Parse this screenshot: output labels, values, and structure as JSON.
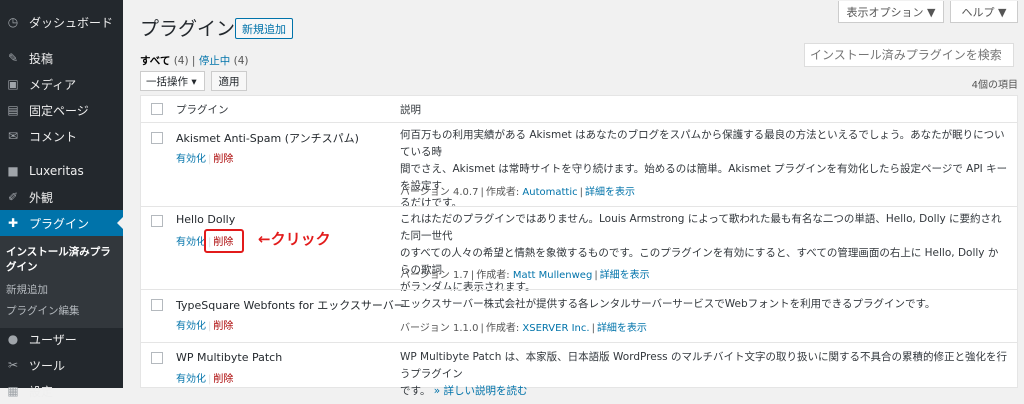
{
  "sidebar": {
    "items": [
      {
        "label": "ダッシュボード",
        "icon": "dashboard-icon",
        "glyph": "◷"
      },
      {
        "label": "投稿",
        "icon": "pin-icon",
        "glyph": "✎"
      },
      {
        "label": "メディア",
        "icon": "media-icon",
        "glyph": "▣"
      },
      {
        "label": "固定ページ",
        "icon": "page-icon",
        "glyph": "▤"
      },
      {
        "label": "コメント",
        "icon": "comment-icon",
        "glyph": "✉"
      },
      {
        "label": "Luxeritas",
        "icon": "theme-icon",
        "glyph": "■"
      },
      {
        "label": "外観",
        "icon": "brush-icon",
        "glyph": "✐"
      },
      {
        "label": "プラグイン",
        "icon": "plugin-icon",
        "glyph": "✚"
      },
      {
        "label": "ユーザー",
        "icon": "user-icon",
        "glyph": "●"
      },
      {
        "label": "ツール",
        "icon": "tool-icon",
        "glyph": "✂"
      },
      {
        "label": "設定",
        "icon": "settings-icon",
        "glyph": "▦"
      }
    ],
    "submenu": {
      "current": "インストール済みプラグイン",
      "items": [
        "新規追加",
        "プラグイン編集"
      ]
    }
  },
  "topbar": {
    "screen_options": "表示オプション ▼",
    "help": "ヘルプ ▼"
  },
  "header": {
    "title": "プラグイン",
    "add_new": "新規追加"
  },
  "filters": {
    "all": "すべて",
    "all_count": "(4)",
    "sep": "|",
    "inactive": "停止中",
    "inactive_count": "(4)"
  },
  "search": {
    "placeholder": "インストール済みプラグインを検索"
  },
  "bulk": {
    "select": "一括操作 ▾",
    "apply": "適用",
    "items_count": "4個の項目"
  },
  "table": {
    "col_plugin": "プラグイン",
    "col_desc": "説明",
    "activate": "有効化",
    "delete": "削除",
    "version_prefix": "バージョン",
    "author_prefix": "作成者:",
    "rows": [
      {
        "name": "Akismet Anti-Spam (アンチスパム)",
        "desc1": "何百万もの利用実績がある Akismet はあなたのブログをスパムから保護する最良の方法といえるでしょう。あなたが眠りについている時",
        "desc2": "間でさえ、Akismet は常時サイトを守り続けます。始めるのは簡単。Akismet プラグインを有効化したら設定ページで API キーを設定す",
        "desc3": "るだけです。",
        "version": "4.0.7",
        "author": "Automattic",
        "details": "詳細を表示"
      },
      {
        "name": "Hello Dolly",
        "desc1": "これはただのプラグインではありません。Louis Armstrong によって歌われた最も有名な二つの単語、Hello, Dolly に要約された同一世代",
        "desc2": "のすべての人々の希望と情熱を象徴するものです。このプラグインを有効にすると、すべての管理画面の右上に Hello, Dolly からの歌詞",
        "desc3": "がランダムに表示されます。",
        "version": "1.7",
        "author": "Matt Mullenweg",
        "details": "詳細を表示"
      },
      {
        "name": "TypeSquare Webfonts for エックスサーバー",
        "desc1": "エックスサーバー株式会社が提供する各レンタルサーバーサービスでWebフォントを利用できるプラグインです。",
        "version": "1.1.0",
        "author": "XSERVER Inc.",
        "details": "詳細を表示"
      },
      {
        "name": "WP Multibyte Patch",
        "desc1": "WP Multibyte Patch は、本家版、日本語版 WordPress のマルチバイト文字の取り扱いに関する不具合の累積的修正と強化を行うプラグイン",
        "desc2": "です。",
        "more": "» 詳しい説明を読む"
      }
    ]
  },
  "annotation": {
    "text": "←クリック"
  }
}
